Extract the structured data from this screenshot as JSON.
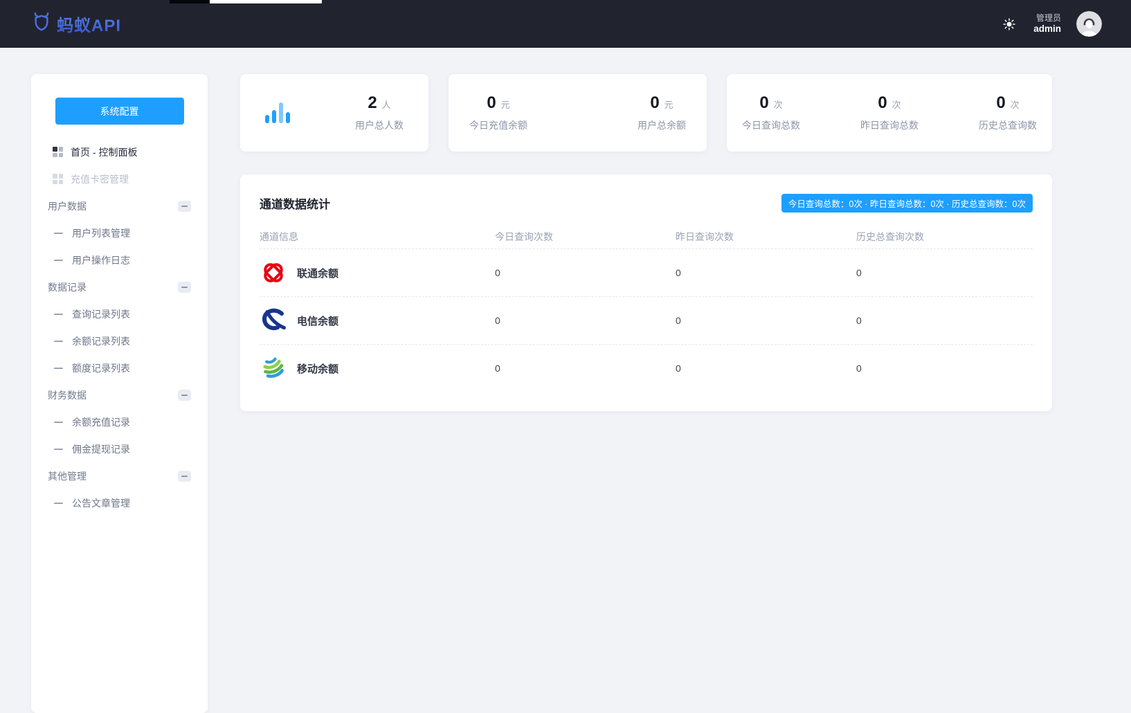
{
  "navbar": {
    "logo_text": "蚂蚁API",
    "user_role": "管理员",
    "user_name": "admin"
  },
  "sidebar": {
    "config_button": "系统配置",
    "items": [
      {
        "label": "首页 - 控制面板"
      },
      {
        "label": "充值卡密管理"
      },
      {
        "label": "用户数据"
      },
      {
        "label": "用户列表管理"
      },
      {
        "label": "用户操作日志"
      },
      {
        "label": "数据记录"
      },
      {
        "label": "查询记录列表"
      },
      {
        "label": "余额记录列表"
      },
      {
        "label": "额度记录列表"
      },
      {
        "label": "财务数据"
      },
      {
        "label": "余额充值记录"
      },
      {
        "label": "佣金提现记录"
      },
      {
        "label": "其他管理"
      },
      {
        "label": "公告文章管理"
      }
    ]
  },
  "stats": [
    {
      "value": "2",
      "unit": "人",
      "label": "用户总人数"
    },
    {
      "value": "0",
      "unit": "元",
      "label": "今日充值余额"
    },
    {
      "value": "0",
      "unit": "元",
      "label": "用户总余额"
    },
    {
      "value": "0",
      "unit": "次",
      "label": "今日查询总数"
    },
    {
      "value": "0",
      "unit": "次",
      "label": "昨日查询总数"
    },
    {
      "value": "0",
      "unit": "次",
      "label": "历史总查询数"
    }
  ],
  "panel": {
    "title": "通道数据统计",
    "badge": "今日查询总数：0次 · 昨日查询总数：0次 · 历史总查询数：0次",
    "headers": [
      "通道信息",
      "今日查询次数",
      "昨日查询次数",
      "历史总查询次数"
    ],
    "rows": [
      {
        "name": "联通余额",
        "icon": "china-unicom-logo",
        "today": "0",
        "yesterday": "0",
        "total": "0"
      },
      {
        "name": "电信余额",
        "icon": "china-telecom-logo",
        "today": "0",
        "yesterday": "0",
        "total": "0"
      },
      {
        "name": "移动余额",
        "icon": "china-mobile-logo",
        "today": "0",
        "yesterday": "0",
        "total": "0"
      }
    ]
  },
  "colors": {
    "accent": "#1e9fff",
    "navbar_bg": "#21232f",
    "page_bg": "#f1f3f7",
    "unicom_red": "#e60012",
    "telecom_blue": "#17348f",
    "mobile_green": "#57b847",
    "mobile_blue": "#2f9cdb"
  }
}
